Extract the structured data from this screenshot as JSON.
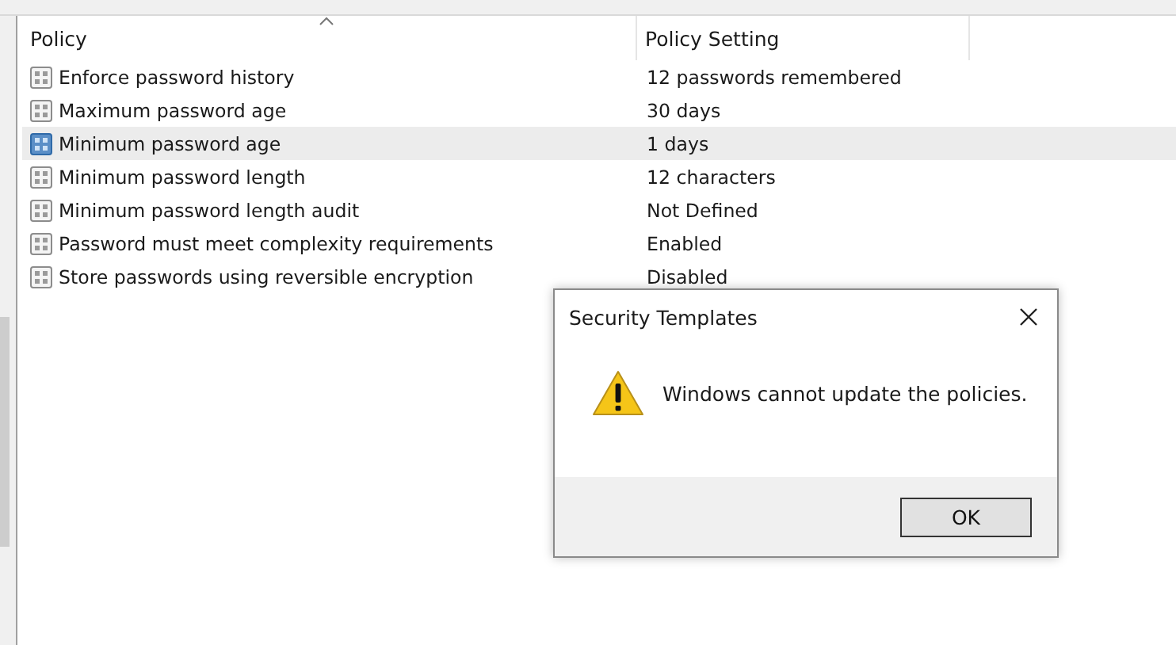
{
  "table": {
    "columns": [
      {
        "label": "Policy",
        "sorted": true
      },
      {
        "label": "Policy Setting",
        "sorted": false
      }
    ],
    "rows": [
      {
        "policy": "Enforce password history",
        "setting": "12 passwords remembered",
        "selected": false
      },
      {
        "policy": "Maximum password age",
        "setting": "30 days",
        "selected": false
      },
      {
        "policy": "Minimum password age",
        "setting": "1 days",
        "selected": true
      },
      {
        "policy": "Minimum password length",
        "setting": "12 characters",
        "selected": false
      },
      {
        "policy": "Minimum password length audit",
        "setting": "Not Defined",
        "selected": false
      },
      {
        "policy": "Password must meet complexity requirements",
        "setting": "Enabled",
        "selected": false
      },
      {
        "policy": "Store passwords using reversible encryption",
        "setting": "Disabled",
        "selected": false
      }
    ]
  },
  "dialog": {
    "title": "Security Templates",
    "message": "Windows cannot update the policies.",
    "buttons": [
      "OK"
    ]
  }
}
